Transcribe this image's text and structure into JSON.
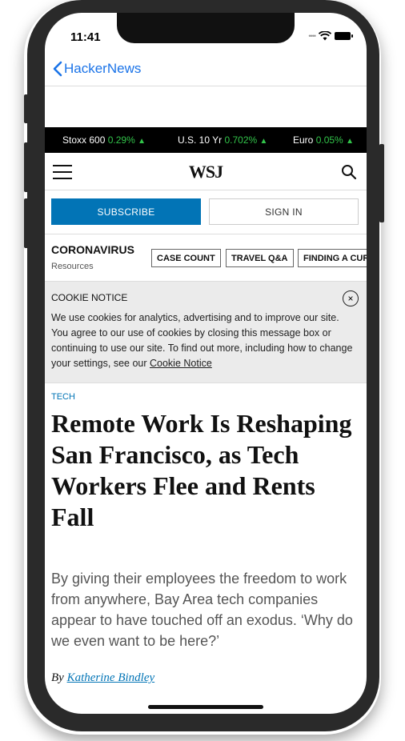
{
  "status_bar": {
    "time": "11:41"
  },
  "nav": {
    "back_label": "HackerNews"
  },
  "ticker": [
    {
      "name": "Stoxx 600",
      "value": "0.29%"
    },
    {
      "name": "U.S. 10 Yr",
      "value": "0.702%"
    },
    {
      "name": "Euro",
      "value": "0.05%"
    }
  ],
  "header": {
    "logo": "WSJ"
  },
  "auth": {
    "subscribe_label": "SUBSCRIBE",
    "signin_label": "SIGN IN"
  },
  "coronavirus": {
    "title": "CORONAVIRUS",
    "subtitle": "Resources",
    "chips": [
      "CASE COUNT",
      "TRAVEL Q&A",
      "FINDING A CUR"
    ]
  },
  "cookie": {
    "title": "COOKIE NOTICE",
    "text": "We use cookies for analytics, advertising and to improve our site. You agree to our use of cookies by closing this message box or continuing to use our site. To find out more, including how to change your settings, see our ",
    "link_label": "Cookie Notice",
    "close_icon": "×"
  },
  "article": {
    "section": "TECH",
    "headline": "Remote Work Is Reshaping San Francisco, as Tech Workers Flee and Rents Fall",
    "dek": "By giving their employees the freedom to work from anywhere, Bay Area tech companies appear to have touched off an exodus. ‘Why do we even want to be here?’",
    "byline_prefix": "By ",
    "author": "Katherine Bindley"
  },
  "colors": {
    "accent": "#0274b6",
    "ticker_up": "#32c44a",
    "ios_link": "#1a73e8"
  }
}
